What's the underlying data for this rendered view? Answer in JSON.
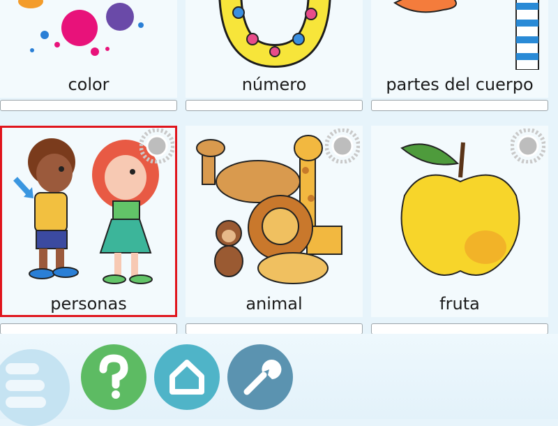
{
  "categories": [
    {
      "label": "color",
      "icon": "paint-splash-illustration"
    },
    {
      "label": "número",
      "icon": "number-zero-illustration"
    },
    {
      "label": "partes del cuerpo",
      "icon": "body-parts-illustration"
    },
    {
      "label": "personas",
      "icon": "boy-and-girl-illustration"
    },
    {
      "label": "animal",
      "icon": "zoo-animals-illustration"
    },
    {
      "label": "fruta",
      "icon": "apple-illustration"
    }
  ],
  "selected": "personas",
  "toolbar": {
    "help_icon": "question-mark-icon",
    "home_icon": "house-icon",
    "settings_icon": "wrench-icon",
    "menu_icon": "hamburger-menu-icon"
  },
  "colors": {
    "selected_border": "#e0141c",
    "help": "#5dbb63",
    "home": "#4fb4c8",
    "settings": "#5b93b0"
  }
}
